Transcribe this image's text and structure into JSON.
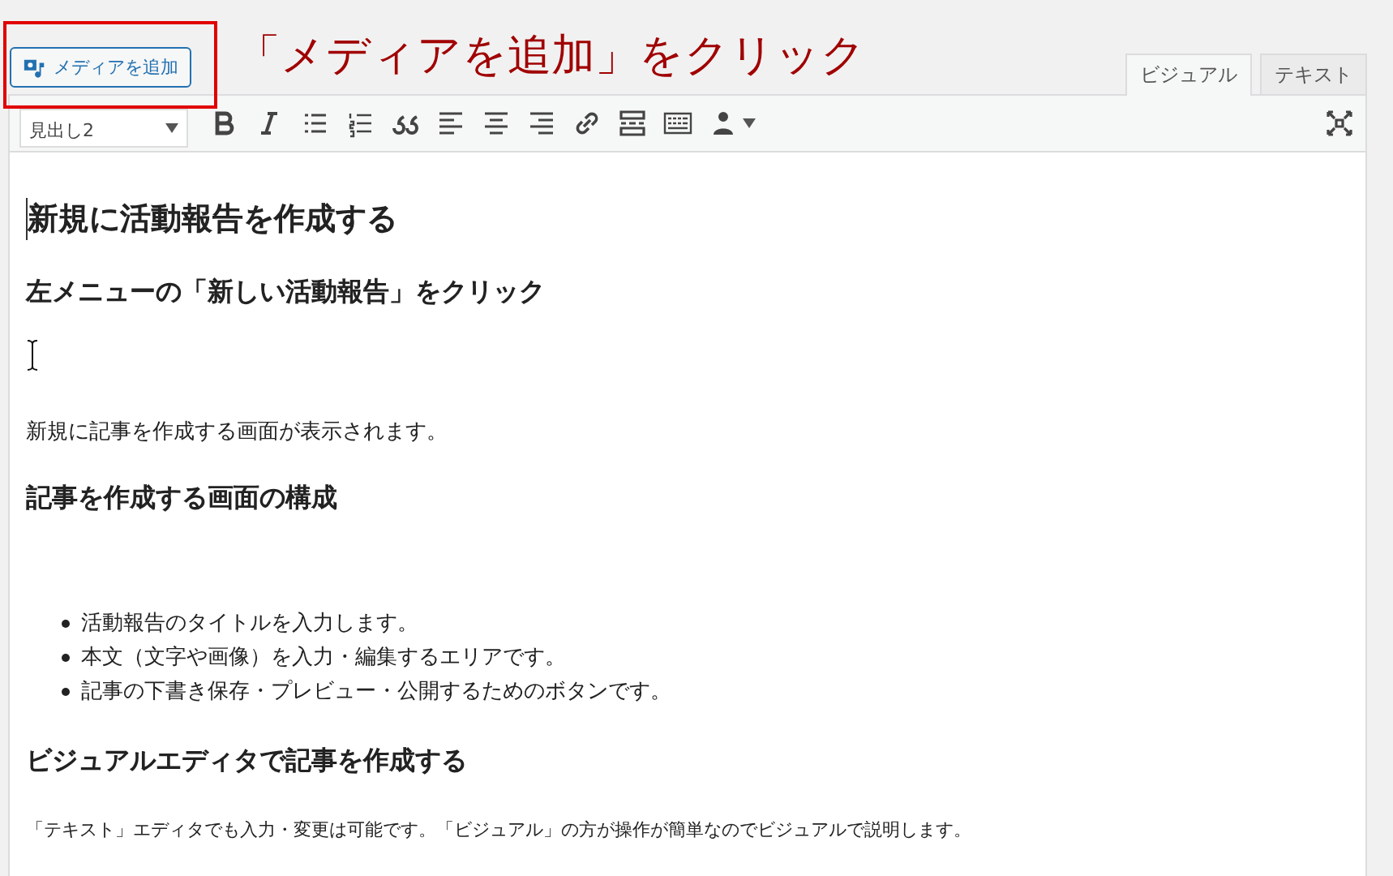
{
  "media_button": {
    "label": "メディアを追加"
  },
  "annotation": {
    "text": "「メディアを追加」をクリック"
  },
  "tabs": [
    {
      "label": "ビジュアル",
      "selected": true
    },
    {
      "label": "テキスト",
      "selected": false
    }
  ],
  "toolbar": {
    "format": "見出し2",
    "tools": [
      {
        "kind": "bold"
      },
      {
        "kind": "italic"
      },
      {
        "kind": "bullets"
      },
      {
        "kind": "numbers"
      },
      {
        "kind": "quote"
      },
      {
        "kind": "align-left"
      },
      {
        "kind": "align-center"
      },
      {
        "kind": "align-right"
      },
      {
        "kind": "link"
      },
      {
        "kind": "more"
      },
      {
        "kind": "kitchen"
      },
      {
        "kind": "person"
      }
    ]
  },
  "content": [
    {
      "kind": "h2",
      "text": "新規に活動報告を作成する"
    },
    {
      "kind": "h3",
      "text": "左メニューの「新しい活動報告」をクリック"
    },
    {
      "kind": "cursor"
    },
    {
      "kind": "p",
      "text": "新規に記事を作成する画面が表示されます。"
    },
    {
      "kind": "h3",
      "text": "記事を作成する画面の構成"
    },
    {
      "kind": "ul",
      "items": [
        "活動報告のタイトルを入力します。",
        "本文（文字や画像）を入力・編集するエリアです。",
        "記事の下書き保存・プレビュー・公開するためのボタンです。"
      ]
    },
    {
      "kind": "h3",
      "text": "ビジュアルエディタで記事を作成する"
    },
    {
      "kind": "small",
      "text": "「テキスト」エディタでも入力・変更は可能です。「ビジュアル」の方が操作が簡単なのでビジュアルで説明します。"
    }
  ]
}
